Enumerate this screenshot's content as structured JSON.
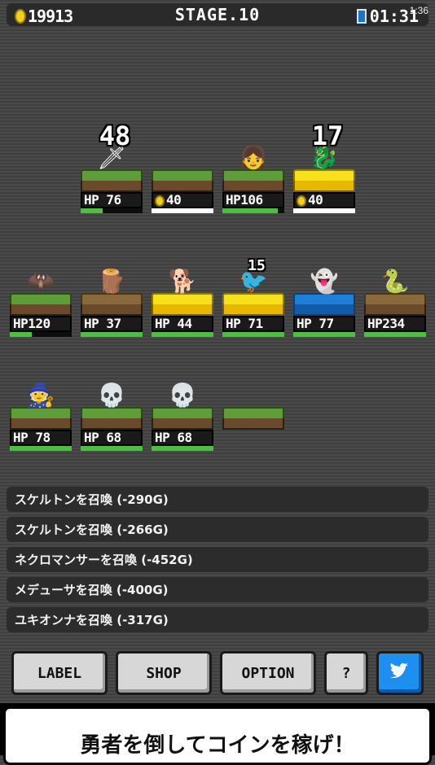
{
  "hud": {
    "coins": "19913",
    "stage": "STAGE.10",
    "timer": "01:31",
    "status_time": "1:36"
  },
  "field": {
    "row1": [
      {
        "kind": "hero",
        "platform": "grass",
        "icon": "hero-sword-icon",
        "glyph": "🗡",
        "damage": "48",
        "hp": "HP 76",
        "hp_fraction": 0.35
      },
      {
        "kind": "reward",
        "platform": "grass",
        "icon": "coin-icon",
        "hp": "40",
        "hp_fraction": 1.0
      },
      {
        "kind": "hero",
        "platform": "grass",
        "icon": "hero-girl-icon",
        "glyph": "👧",
        "damage": "",
        "hp": "HP106",
        "hp_fraction": 0.9
      },
      {
        "kind": "reward",
        "platform": "gold",
        "icon": "dragon-icon",
        "glyph": "🐉",
        "damage": "17",
        "hp": "40",
        "hp_fraction": 1.0
      }
    ],
    "row2": [
      {
        "platform": "grass",
        "icon": "bat-icon",
        "glyph": "🦇",
        "damage": "",
        "hp": "HP120",
        "hp_fraction": 0.35
      },
      {
        "platform": "wood",
        "icon": "treant-icon",
        "glyph": "🪵",
        "damage": "",
        "hp": "HP 37",
        "hp_fraction": 1.0
      },
      {
        "platform": "gold",
        "icon": "dog-icon",
        "glyph": "🐕",
        "damage": "",
        "hp": "HP 44",
        "hp_fraction": 1.0
      },
      {
        "platform": "gold",
        "icon": "bird-icon",
        "glyph": "🐦",
        "damage": "15",
        "hp": "HP 71",
        "hp_fraction": 1.0
      },
      {
        "platform": "blue",
        "icon": "yukionna-icon",
        "glyph": "👻",
        "damage": "",
        "hp": "HP 77",
        "hp_fraction": 1.0
      },
      {
        "platform": "wood",
        "icon": "medusa-icon",
        "glyph": "🐍",
        "damage": "",
        "hp": "HP234",
        "hp_fraction": 1.0
      }
    ],
    "row3": [
      {
        "platform": "grass",
        "icon": "necromancer-icon",
        "glyph": "🧙",
        "damage": "",
        "hp": "HP 78",
        "hp_fraction": 1.0
      },
      {
        "platform": "grass",
        "icon": "skeleton-icon",
        "glyph": "💀",
        "damage": "",
        "hp": "HP 68",
        "hp_fraction": 1.0
      },
      {
        "platform": "grass",
        "icon": "skeleton-icon",
        "glyph": "💀",
        "damage": "",
        "hp": "HP 68",
        "hp_fraction": 1.0
      },
      {
        "platform": "grass",
        "icon": "empty-slot-icon",
        "glyph": "",
        "damage": "",
        "hp": "",
        "hp_fraction": 0
      }
    ]
  },
  "summons": [
    "スケルトンを召喚 (-290G)",
    "スケルトンを召喚 (-266G)",
    "ネクロマンサーを召喚 (-452G)",
    "メデューサを召喚 (-400G)",
    "ユキオンナを召喚 (-317G)"
  ],
  "buttons": {
    "label": "LABEL",
    "shop": "SHOP",
    "option": "OPTION",
    "help": "?",
    "twitter_icon": "twitter-bird-icon"
  },
  "banner": "勇者を倒してコインを稼げ！"
}
